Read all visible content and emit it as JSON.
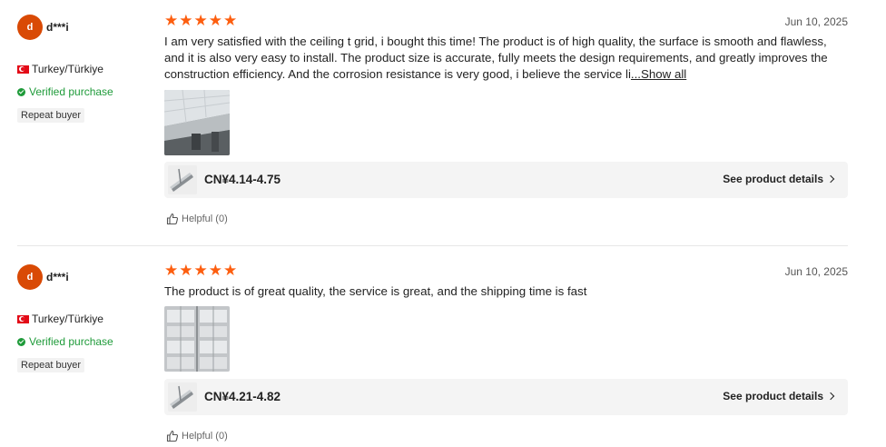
{
  "reviews": [
    {
      "avatar_letter": "d",
      "username": "d***i",
      "country": "Turkey/Türkiye",
      "verified": "Verified purchase",
      "badge": "Repeat buyer",
      "rating": 5,
      "date": "Jun 10, 2025",
      "text": "I am very satisfied with the ceiling t grid, i bought this time! The product is of high quality, the surface is smooth and flawless, and it is also very easy to install. The product size is accurate, fully meets the design requirements, and greatly improves the construction efficiency. And the corrosion resistance is very good, i believe the service li",
      "show_all": "...Show all",
      "price": "CN¥4.14-4.75",
      "details_link": "See product details",
      "helpful": "Helpful (0)"
    },
    {
      "avatar_letter": "d",
      "username": "d***i",
      "country": "Turkey/Türkiye",
      "verified": "Verified purchase",
      "badge": "Repeat buyer",
      "rating": 5,
      "date": "Jun 10, 2025",
      "text": "The product is of great quality, the service is great, and the shipping time is fast",
      "price": "CN¥4.21-4.82",
      "details_link": "See product details",
      "helpful": "Helpful (0)"
    }
  ],
  "icons": {
    "star": "star-icon",
    "flag": "turkey-flag-icon",
    "verified": "verified-check-icon",
    "thumbs_up": "thumbs-up-icon",
    "chevron": "chevron-right-icon"
  },
  "colors": {
    "star": "#fd5e0f",
    "avatar": "#d94a05",
    "verified": "#1f9b3a"
  }
}
